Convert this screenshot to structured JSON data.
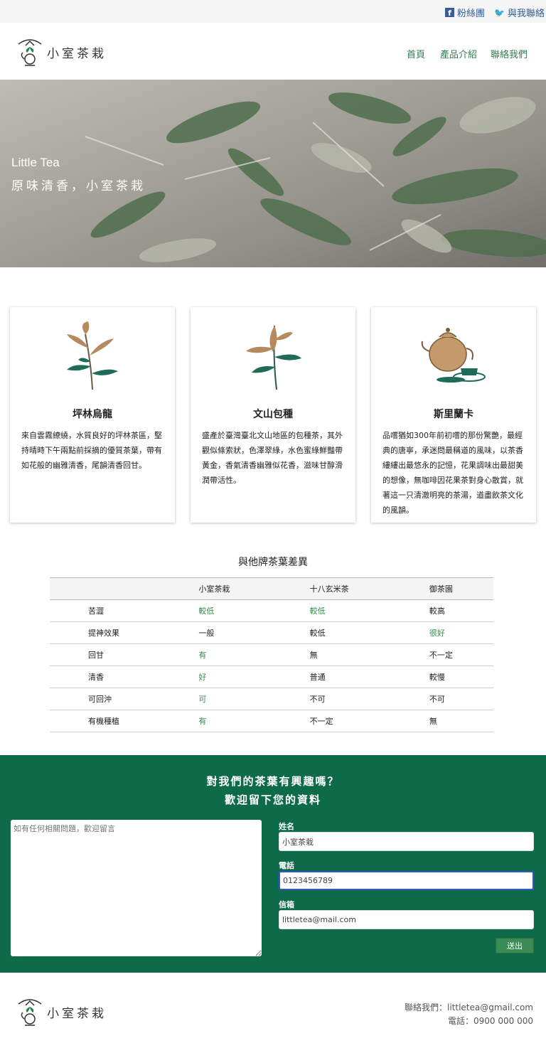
{
  "topbar": {
    "facebook_label": "粉絲團",
    "twitter_label": "與我聯絡"
  },
  "brand": {
    "name": "小室茶栽"
  },
  "nav": {
    "items": [
      "首頁",
      "產品介紹",
      "聯絡我們"
    ]
  },
  "hero": {
    "title": "Little Tea",
    "subtitle": "原味清香，小室茶栽"
  },
  "products": [
    {
      "name": "坪林烏龍",
      "desc": "來自雲霧繚繞，水質良好的坪林茶區，堅持晴時下午兩點前採摘的優質茶葉，帶有如花般的幽雅清香，尾韻清香回甘。"
    },
    {
      "name": "文山包種",
      "desc": "盛產於臺灣臺北文山地區的包種茶，其外觀似條索狀，色澤翠綠，水色蜜綠鮮豔帶黃金，香氣清香幽雅似花香，滋味甘醇滑潤帶活性。"
    },
    {
      "name": "斯里蘭卡",
      "desc": "品嚐猶如300年前初嚐的那份驚艷，最經典的唐寧，承迷問最稱道的風味，以茶香縷縷出最悠永的記憶，花果調味出最甜美的想像，無咖啡因花果茶對身心散賞，就著這一只清澈明亮的茶湯，道盡飲茶文化的風韻。"
    }
  ],
  "comparison": {
    "title": "與他牌茶葉差異",
    "headers": [
      "",
      "小室茶栽",
      "十八玄米茶",
      "御茶園"
    ],
    "rows": [
      [
        "苦澀",
        "較低",
        "較低",
        "較高"
      ],
      [
        "提神效果",
        "一般",
        "較低",
        "很好"
      ],
      [
        "回甘",
        "有",
        "無",
        "不一定"
      ],
      [
        "清香",
        "好",
        "普通",
        "較慢"
      ],
      [
        "可回沖",
        "可",
        "不可",
        "不可"
      ],
      [
        "有機種植",
        "有",
        "不一定",
        "無"
      ]
    ],
    "highlight_color": "#3a8a4f"
  },
  "contact": {
    "heading1": "對我們的茶葉有興趣嗎？",
    "heading2": "歡迎留下您的資料",
    "message_placeholder": "如有任何相關問題，歡迎留言",
    "name_label": "姓名",
    "name_value": "小室茶栽",
    "phone_label": "電話",
    "phone_value": "0123456789",
    "email_label": "信箱",
    "email_value": "littletea@mail.com",
    "submit_label": "送出",
    "background_color": "#0d6b4a"
  },
  "footer": {
    "email_line": "聯絡我們：littletea@gmail.com",
    "phone_line": "電話：0900 000 000"
  }
}
